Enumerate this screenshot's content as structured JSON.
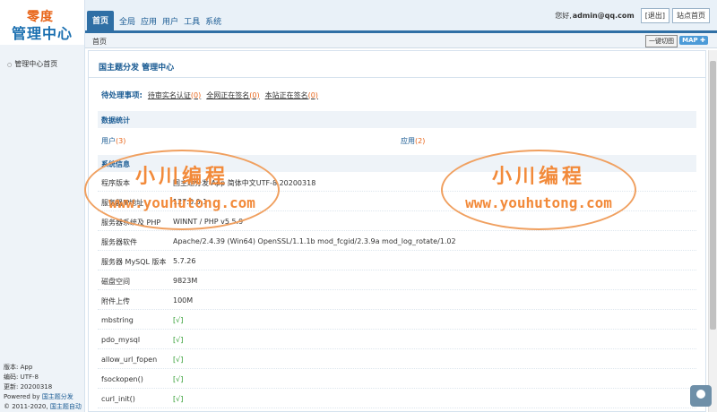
{
  "logo": {
    "top": "零度",
    "bottom": "管理中心"
  },
  "nav": {
    "tabs": [
      "首页",
      "全局",
      "应用",
      "用户",
      "工具",
      "系统"
    ]
  },
  "user": {
    "greeting": "您好,",
    "name": "admin@qq.com",
    "logout": "[退出]",
    "site_home": "站点首页"
  },
  "breadcrumb": {
    "current": "首页",
    "screenshot_btn": "一键切图",
    "map_btn": "MAP"
  },
  "sidebar": {
    "items": [
      {
        "label": "管理中心首页"
      }
    ],
    "info": {
      "version": "版本: App",
      "encoding": "编码: UTF-8",
      "updated": "更新: 20200318",
      "powered_prefix": "Powered by",
      "powered_link": "国主题分发",
      "copyright_prefix": "© 2011-2020,",
      "copyright_link": "国主题自动签名系统 Inc."
    }
  },
  "main": {
    "title": "国主题分发 管理中心",
    "pending": {
      "label": "待处理事项:",
      "items": [
        {
          "text": "待审实名认证",
          "count": "(0)"
        },
        {
          "text": "全网正在签名",
          "count": "(0)"
        },
        {
          "text": "本站正在签名",
          "count": "(0)"
        }
      ]
    },
    "stats": {
      "heading": "数据统计",
      "users_label": "用户",
      "users_count": "(3)",
      "apps_label": "应用",
      "apps_count": "(2)"
    },
    "system": {
      "heading": "系统信息",
      "rows": [
        {
          "label": "程序版本",
          "value": "国主题分发 App 简体中文UTF-8 20200318"
        },
        {
          "label": "服务器IP地址",
          "value": "127.0.0.1"
        },
        {
          "label": "服务器系统及 PHP",
          "value": "WINNT / PHP v5.5.9"
        },
        {
          "label": "服务器软件",
          "value": "Apache/2.4.39 (Win64) OpenSSL/1.1.1b mod_fcgid/2.3.9a mod_log_rotate/1.02"
        },
        {
          "label": "服务器 MySQL 版本",
          "value": "5.7.26"
        },
        {
          "label": "磁盘空间",
          "value": "9823M"
        },
        {
          "label": "附件上传",
          "value": "100M"
        },
        {
          "label": "mbstring",
          "value": "[√]"
        },
        {
          "label": "pdo_mysql",
          "value": "[√]"
        },
        {
          "label": "allow_url_fopen",
          "value": "[√]"
        },
        {
          "label": "fsockopen()",
          "value": "[√]"
        },
        {
          "label": "curl_init()",
          "value": "[√]"
        }
      ]
    }
  },
  "watermark": {
    "top": "小川编程",
    "bottom": "www.youhutong.com"
  },
  "colors": {
    "brand_blue": "#2f6fa5",
    "link_blue": "#1a5b93",
    "accent_orange": "#e8651a",
    "ok_green": "#2a9a2a"
  }
}
